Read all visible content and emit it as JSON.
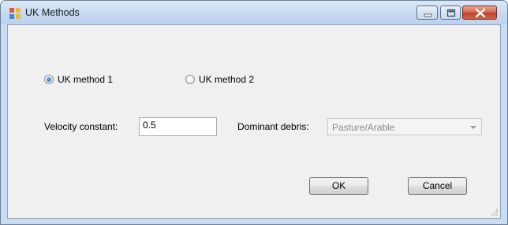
{
  "window": {
    "title": "UK Methods",
    "controls": {
      "minimize": "minimize-icon",
      "maximize": "maximize-icon",
      "close": "close-icon"
    }
  },
  "form": {
    "radio1": {
      "label": "UK method 1",
      "checked": true
    },
    "radio2": {
      "label": "UK method 2",
      "checked": false
    },
    "velocity_label": "Velocity constant:",
    "velocity_value": "0.5",
    "debris_label": "Dominant debris:",
    "debris_value": "Pasture/Arable",
    "debris_enabled": false
  },
  "buttons": {
    "ok": "OK",
    "cancel": "Cancel"
  },
  "colors": {
    "titlebar": "#c6d9f1",
    "close": "#c0432b",
    "client": "#f0f0f0",
    "radio_selected": "#1d5fb5"
  }
}
